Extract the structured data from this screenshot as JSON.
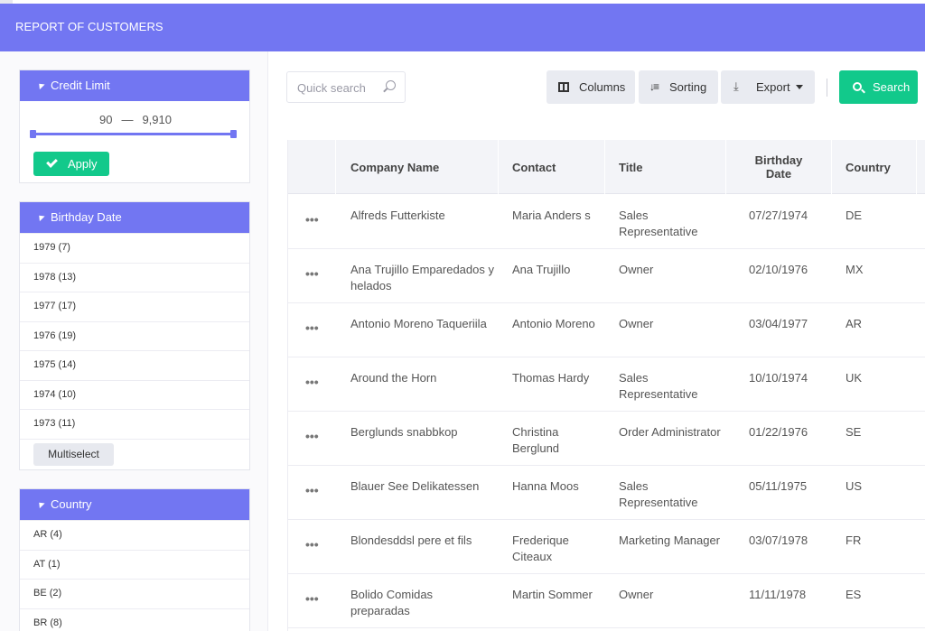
{
  "header": {
    "title": "REPORT OF CUSTOMERS"
  },
  "sidebar": {
    "credit_limit": {
      "title": "Credit Limit",
      "min": "90",
      "separator": "—",
      "max": "9,910",
      "apply_label": "Apply"
    },
    "birthday_date": {
      "title": "Birthday Date",
      "items": [
        "1979 (7)",
        "1978 (13)",
        "1977 (17)",
        "1976 (19)",
        "1975 (14)",
        "1974 (10)",
        "1973 (11)"
      ],
      "multiselect_label": "Multiselect"
    },
    "country": {
      "title": "Country",
      "items": [
        "AR (4)",
        "AT (1)",
        "BE (2)",
        "BR (8)"
      ]
    }
  },
  "toolbar": {
    "search_placeholder": "Quick search",
    "columns_label": "Columns",
    "sorting_label": "Sorting",
    "export_label": "Export",
    "search_label": "Search"
  },
  "table": {
    "columns": [
      "Company Name",
      "Contact",
      "Title",
      "Birthday Date",
      "Country"
    ],
    "rows": [
      {
        "company": "Alfreds Futterkiste",
        "contact": "Maria Anders s",
        "title": "Sales Representative",
        "birthday": "07/27/1974",
        "country": "DE"
      },
      {
        "company": "Ana Trujillo Emparedados y helados",
        "contact": "Ana Trujillo",
        "title": "Owner",
        "birthday": "02/10/1976",
        "country": "MX"
      },
      {
        "company": "Antonio Moreno Taqueriila",
        "contact": "Antonio Moreno",
        "title": "Owner",
        "birthday": "03/04/1977",
        "country": "AR"
      },
      {
        "company": "Around the Horn",
        "contact": "Thomas Hardy",
        "title": "Sales Representative",
        "birthday": "10/10/1974",
        "country": "UK"
      },
      {
        "company": "Berglunds snabbkop",
        "contact": "Christina Berglund",
        "title": "Order Administrator",
        "birthday": "01/22/1976",
        "country": "SE"
      },
      {
        "company": "Blauer See Delikatessen",
        "contact": "Hanna Moos",
        "title": "Sales Representative",
        "birthday": "05/11/1975",
        "country": "US"
      },
      {
        "company": "Blondesddsl pere et fils",
        "contact": "Frederique Citeaux",
        "title": "Marketing Manager",
        "birthday": "03/07/1978",
        "country": "FR"
      },
      {
        "company": "Bolido Comidas preparadas",
        "contact": "Martin Sommer",
        "title": "Owner",
        "birthday": "11/11/1978",
        "country": "ES"
      }
    ]
  }
}
